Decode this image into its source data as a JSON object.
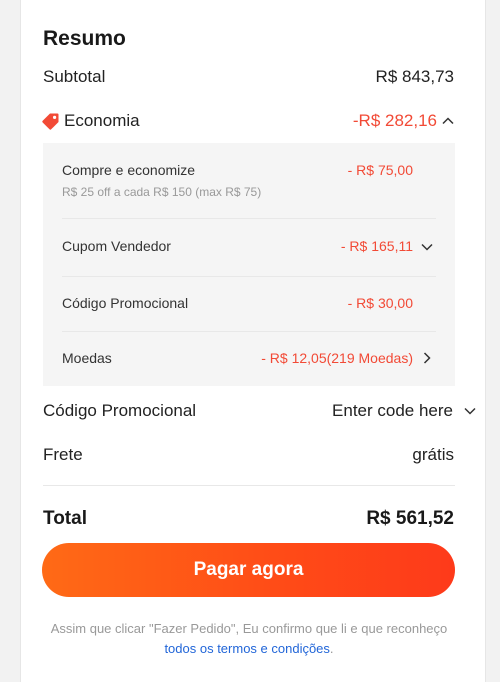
{
  "summary": {
    "title": "Resumo",
    "subtotal_label": "Subtotal",
    "subtotal_value": "R$ 843,73",
    "savings_label": "Economia",
    "savings_value": "-R$ 282,16",
    "breakdown": [
      {
        "label": "Compre e economize",
        "sub": "R$ 25 off a cada R$ 150 (max R$ 75)",
        "value": "- R$ 75,00"
      },
      {
        "label": "Cupom Vendedor",
        "value": "- R$ 165,11"
      },
      {
        "label": "Código Promocional",
        "value": "- R$ 30,00"
      },
      {
        "label": "Moedas",
        "value": "- R$ 12,05(219 Moedas)"
      }
    ],
    "promo_label": "Código Promocional",
    "promo_placeholder": "Enter code here",
    "shipping_label": "Frete",
    "shipping_value": "grátis",
    "total_label": "Total",
    "total_value": "R$ 561,52"
  },
  "pay_button_label": "Pagar agora",
  "disclaimer": {
    "text": "Assim que clicar \"Fazer Pedido\", Eu confirmo que li e que reconheço",
    "link": "todos os termos e condições",
    "end": "."
  },
  "colors": {
    "accent": "#f24a36",
    "button_start": "#ff6a16",
    "button_end": "#fe3a1a",
    "link": "#2266d8"
  },
  "icons": {
    "savings": "tag-icon",
    "collapse": "chevron-up-icon",
    "expand": "chevron-down-icon",
    "navigate": "chevron-right-icon"
  }
}
